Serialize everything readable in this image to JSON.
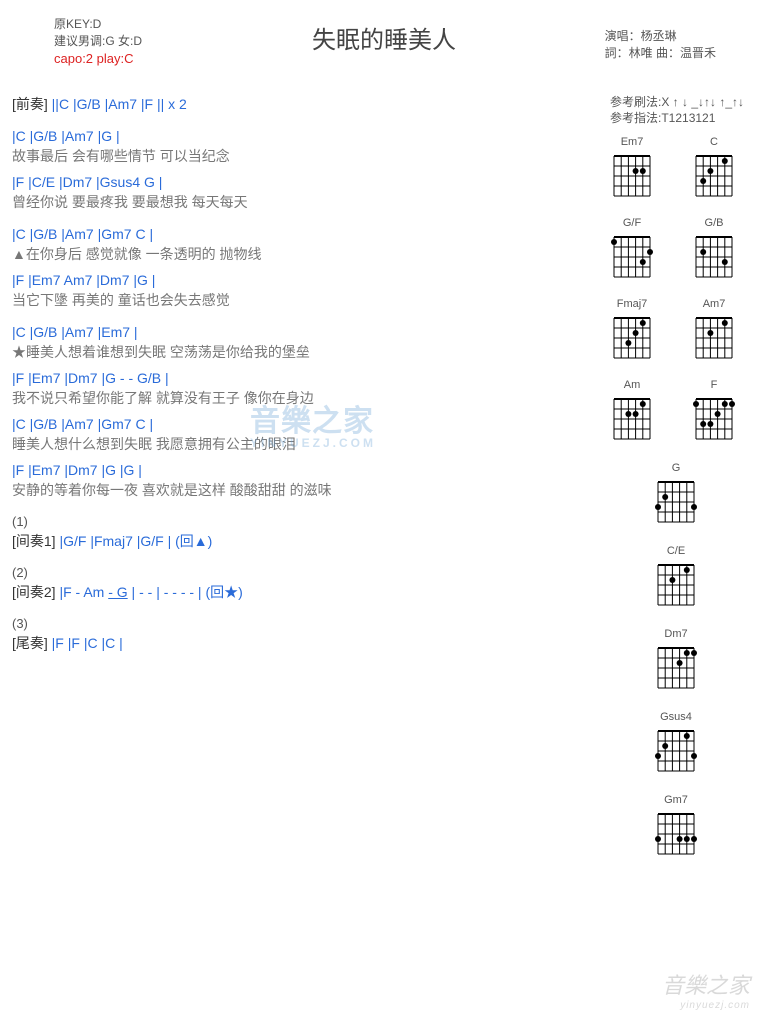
{
  "title": "失眠的睡美人",
  "key_info": {
    "original_key": "原KEY:D",
    "suggest": "建议男调:G 女:D",
    "capo": "capo:2 play:C"
  },
  "credits": {
    "singer_label": "演唱：",
    "singer": "杨丞琳",
    "lyric_label": "詞：",
    "lyricist": "林唯",
    "compose_label": "曲：",
    "composer": "温晋禾"
  },
  "reference": {
    "strum_label": "参考刷法:",
    "strum": "X ↑ ↓ _↓↑↓ ↑_↑↓",
    "pick_label": "参考指法:",
    "pick": "T1213121"
  },
  "intro": {
    "label": "[前奏]",
    "chords": " ||C     |G/B    |Am7    |F      || x 2"
  },
  "verse1": {
    "l1c": "|C            |G/B            |Am7          |G    |",
    "l1t": "  故事最后     会有哪些情节    可以当纪念",
    "l2c": "          |F           |C/E          |Dm7          |Gsus4    G    |",
    "l2t": "  曾经你说    要最疼我    要最想我    每天每天"
  },
  "verse2": {
    "l1c": "|C            |G/B           |Am7           |Gm7    C   |",
    "l1t": "▲在你身后    感觉就像    一条透明的    抛物线",
    "l2c": "|F          |Em7    Am7    |Dm7                    |G    |",
    "l2t": "  当它下墬    再美的       童话也会失去感觉"
  },
  "chorus": {
    "l1c": "        |C             |G/B        |Am7             |Em7    |",
    "l1t": "★睡美人想着谁想到失眠     空荡荡是你给我的堡垒",
    "l2c": "        |F                 |Em7             |Dm7              |G  -  -  G/B   |",
    "l2t": "  我不说只希望你能了解    就算没有王子    像你在身边",
    "l3c": "        |C             |G/B       |Am7            |Gm7    C   |",
    "l3t": "  睡美人想什么想到失眠    我愿意拥有公主的眼泪",
    "l4c": "        |F               |Em7              |Dm7            |G    |G      |",
    "l4t": "  安静的等着你每一夜    喜欢就是这样     酸酸甜甜    的滋味"
  },
  "interlude1": {
    "num": "(1)",
    "label": "[间奏1]",
    "chords": " |G/F    |Fmaj7    |G/F    |  (回▲)"
  },
  "interlude2": {
    "num": "(2)",
    "label": "[间奏2]",
    "chords": " |F   -   Am ",
    "chords_u": "  - G",
    "chords2": "  |  -  - | -  -  -  - |  (回★)"
  },
  "outro": {
    "num": "(3)",
    "label": "[尾奏]",
    "chords": " |F    |F    |C    |C     |"
  },
  "chord_diagrams_pairs": [
    [
      "Em7",
      "C"
    ],
    [
      "G/F",
      "G/B"
    ],
    [
      "Fmaj7",
      "Am7"
    ],
    [
      "Am",
      "F"
    ]
  ],
  "chord_diagrams_single": [
    "G",
    "C/E",
    "Dm7",
    "Gsus4",
    "Gm7"
  ],
  "watermark": "音樂之家",
  "watermark_sub": "YINYUEZJ.COM",
  "footer_wm": "音樂之家",
  "footer_wm_sub": "yinyuezj.com"
}
